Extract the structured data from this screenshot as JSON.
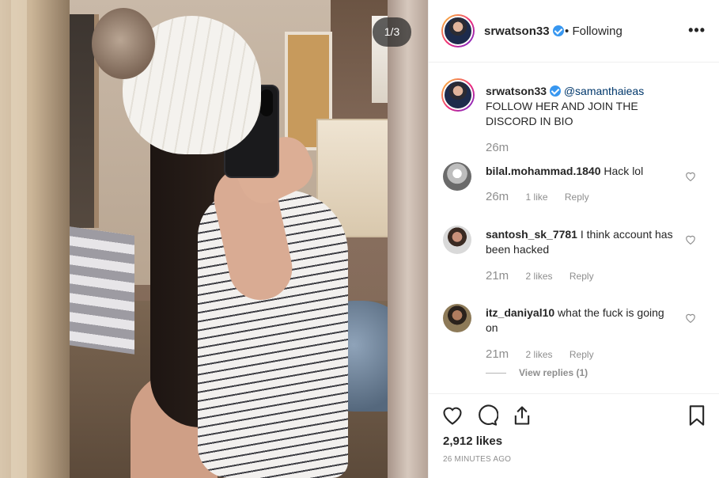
{
  "post": {
    "image_counter": "1/3",
    "image_alt": "Mirror selfie photo"
  },
  "header": {
    "username": "srwatson33",
    "separator": "•",
    "follow_status": "Following",
    "more_icon": "more-horizontal-icon"
  },
  "caption": {
    "username": "srwatson33",
    "mention": "@samanthaieas",
    "text": "FOLLOW HER AND JOIN THE DISCORD IN BIO",
    "time": "26m"
  },
  "comments": [
    {
      "username": "bilal.mohammad.1840",
      "text": "Hack lol",
      "time": "26m",
      "likes": "1 like",
      "reply": "Reply",
      "avatar_color": "#d8d8d8"
    },
    {
      "username": "santosh_sk_7781",
      "text": "I think account has been hacked",
      "time": "21m",
      "likes": "2 likes",
      "reply": "Reply",
      "avatar_color": "#6b4c3d"
    },
    {
      "username": "itz_daniyal10",
      "text": "what the fuck is going on",
      "time": "21m",
      "likes": "2 likes",
      "reply": "Reply",
      "avatar_color": "#4a3b2a"
    }
  ],
  "view_replies": "View replies (1)",
  "actions": {
    "icons": [
      "heart-icon",
      "comment-icon",
      "share-icon",
      "bookmark-icon"
    ],
    "likes": "2,912 likes",
    "time_ago": "26 MINUTES AGO"
  },
  "colors": {
    "verified": "#3897f0",
    "mention": "#00376b",
    "muted": "#8e8e8e",
    "text": "#262626"
  }
}
